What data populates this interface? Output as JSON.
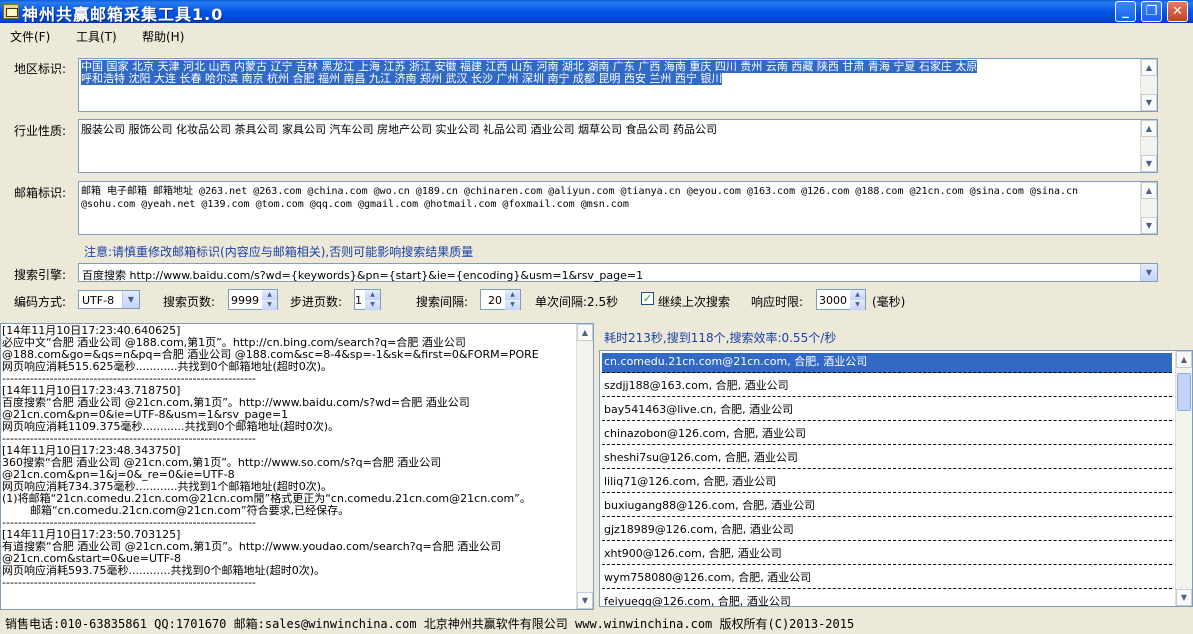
{
  "window": {
    "title": "神州共赢邮箱采集工具1.0"
  },
  "menu": [
    "文件(F)",
    "工具(T)",
    "帮助(H)"
  ],
  "region": {
    "label": "地区标识:",
    "line1": "中国 国家 北京 天津 河北 山西 内蒙古 辽宁 吉林 黑龙江 上海 江苏 浙江 安徽 福建 江西 山东 河南 湖北 湖南 广东 广西 海南 重庆 四川 贵州 云南 西藏 陕西 甘肃 青海 宁夏 石家庄 太原",
    "line2": "呼和浩特 沈阳 大连 长春 哈尔滨 南京 杭州 合肥 福州 南昌 九江 济南 郑州 武汉 长沙 广州 深圳 南宁 成都 昆明 西安 兰州 西宁 银川"
  },
  "industry": {
    "label": "行业性质:",
    "value": "服装公司 服饰公司 化妆品公司 茶具公司 家具公司 汽车公司 房地产公司 实业公司 礼品公司 酒业公司 烟草公司 食品公司 药品公司"
  },
  "mailbox": {
    "label": "邮箱标识:",
    "line1": "邮箱 电子邮箱 邮箱地址 @263.net @263.com @china.com @wo.cn @189.cn @chinaren.com @aliyun.com @tianya.cn @eyou.com @163.com @126.com @188.com @21cn.com @sina.com @sina.cn",
    "line2": "@sohu.com @yeah.net @139.com @tom.com @qq.com @gmail.com @hotmail.com @foxmail.com @msn.com"
  },
  "note": "注意:请慎重修改邮箱标识(内容应与邮箱相关),否则可能影响搜索结果质量",
  "engine": {
    "label": "搜索引擎:",
    "value": "百度搜索 http://www.baidu.com/s?wd={keywords}&pn={start}&ie={encoding}&usm=1&rsv_page=1"
  },
  "options": {
    "encoding_label": "编码方式:",
    "encoding_value": "UTF-8",
    "pages_label": "搜索页数:",
    "pages_value": "9999",
    "step_label": "步进页数:",
    "step_value": "1",
    "interval_label": "搜索间隔:",
    "interval_value": "20",
    "single_interval": "单次间隔:2.5秒",
    "continue_label": "继续上次搜索",
    "timeout_label": "响应时限:",
    "timeout_value": "3000",
    "timeout_unit": "(毫秒)"
  },
  "log": [
    "[14年11月10日17:23:40.640625]",
    "必应中文“合肥 酒业公司 @188.com,第1页”。http://cn.bing.com/search?q=合肥 酒业公司",
    "@188.com&go=&qs=n&pq=合肥 酒业公司 @188.com&sc=8-4&sp=-1&sk=&first=0&FORM=PORE",
    "网页响应消耗515.625毫秒............共找到0个邮箱地址(超时0次)。",
    "----------------------------------------------------------------",
    "[14年11月10日17:23:43.718750]",
    "百度搜索“合肥 酒业公司 @21cn.com,第1页”。http://www.baidu.com/s?wd=合肥 酒业公司",
    "@21cn.com&pn=0&ie=UTF-8&usm=1&rsv_page=1",
    "网页响应消耗1109.375毫秒............共找到0个邮箱地址(超时0次)。",
    "----------------------------------------------------------------",
    "[14年11月10日17:23:48.343750]",
    "360搜索“合肥 酒业公司 @21cn.com,第1页”。http://www.so.com/s?q=合肥 酒业公司",
    "@21cn.com&pn=1&j=0&_re=0&ie=UTF-8",
    "网页响应消耗734.375毫秒............共找到1个邮箱地址(超时0次)。",
    "(1)将邮箱“21cn.comedu.21cn.com@21cn.com閒”格式更正为“cn.comedu.21cn.com@21cn.com”。",
    "        邮箱“cn.comedu.21cn.com@21cn.com”符合要求,已经保存。",
    "----------------------------------------------------------------",
    "[14年11月10日17:23:50.703125]",
    "有道搜索“合肥 酒业公司 @21cn.com,第1页”。http://www.youdao.com/search?q=合肥 酒业公司",
    "@21cn.com&start=0&ue=UTF-8",
    "网页响应消耗593.75毫秒............共找到0个邮箱地址(超时0次)。",
    "----------------------------------------------------------------"
  ],
  "stats": "耗时213秒,搜到118个,搜索效率:0.55个/秒",
  "results": [
    "cn.comedu.21cn.com@21cn.com, 合肥, 酒业公司",
    "szdjj188@163.com, 合肥, 酒业公司",
    "bay541463@live.cn, 合肥, 酒业公司",
    "chinazobon@126.com, 合肥, 酒业公司",
    "sheshi7su@126.com, 合肥, 酒业公司",
    "liliq71@126.com, 合肥, 酒业公司",
    "buxiugang88@126.com, 合肥, 酒业公司",
    "gjz18989@126.com, 合肥, 酒业公司",
    "xht900@126.com, 合肥, 酒业公司",
    "wym758080@126.com, 合肥, 酒业公司",
    "feiyuegg@126.com, 合肥, 酒业公司"
  ],
  "status": "销售电话:010-63835861 QQ:1701670 邮箱:sales@winwinchina.com 北京神州共赢软件有限公司 www.winwinchina.com 版权所有(C)2013-2015"
}
